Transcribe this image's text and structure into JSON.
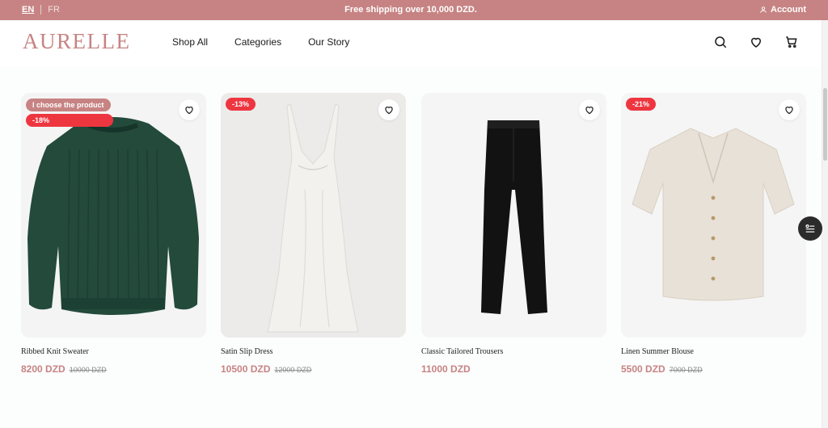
{
  "topbar": {
    "lang_en": "EN",
    "lang_fr": "FR",
    "shipping": "Free shipping over 10,000 DZD.",
    "account": "Account"
  },
  "header": {
    "logo": "AURELLE",
    "nav": [
      "Shop All",
      "Categories",
      "Our Story"
    ],
    "icons": [
      "search-icon",
      "heart-icon",
      "cart-icon"
    ]
  },
  "products": [
    {
      "name": "Ribbed Knit Sweater",
      "price": "8200 DZD",
      "old_price": "10000 DZD",
      "choose_badge": "I choose the product",
      "discount": "-18%",
      "image": "sweater"
    },
    {
      "name": "Satin Slip Dress",
      "price": "10500 DZD",
      "old_price": "12000 DZD",
      "discount": "-13%",
      "image": "dress"
    },
    {
      "name": "Classic Tailored Trousers",
      "price": "11000 DZD",
      "image": "trousers"
    },
    {
      "name": "Linen Summer Blouse",
      "price": "5500 DZD",
      "old_price": "7000 DZD",
      "discount": "-21%",
      "image": "blouse"
    }
  ],
  "colors": {
    "brand": "#c78383",
    "discount_badge": "#ee3640"
  },
  "floating": {
    "icon": "filter-icon"
  }
}
